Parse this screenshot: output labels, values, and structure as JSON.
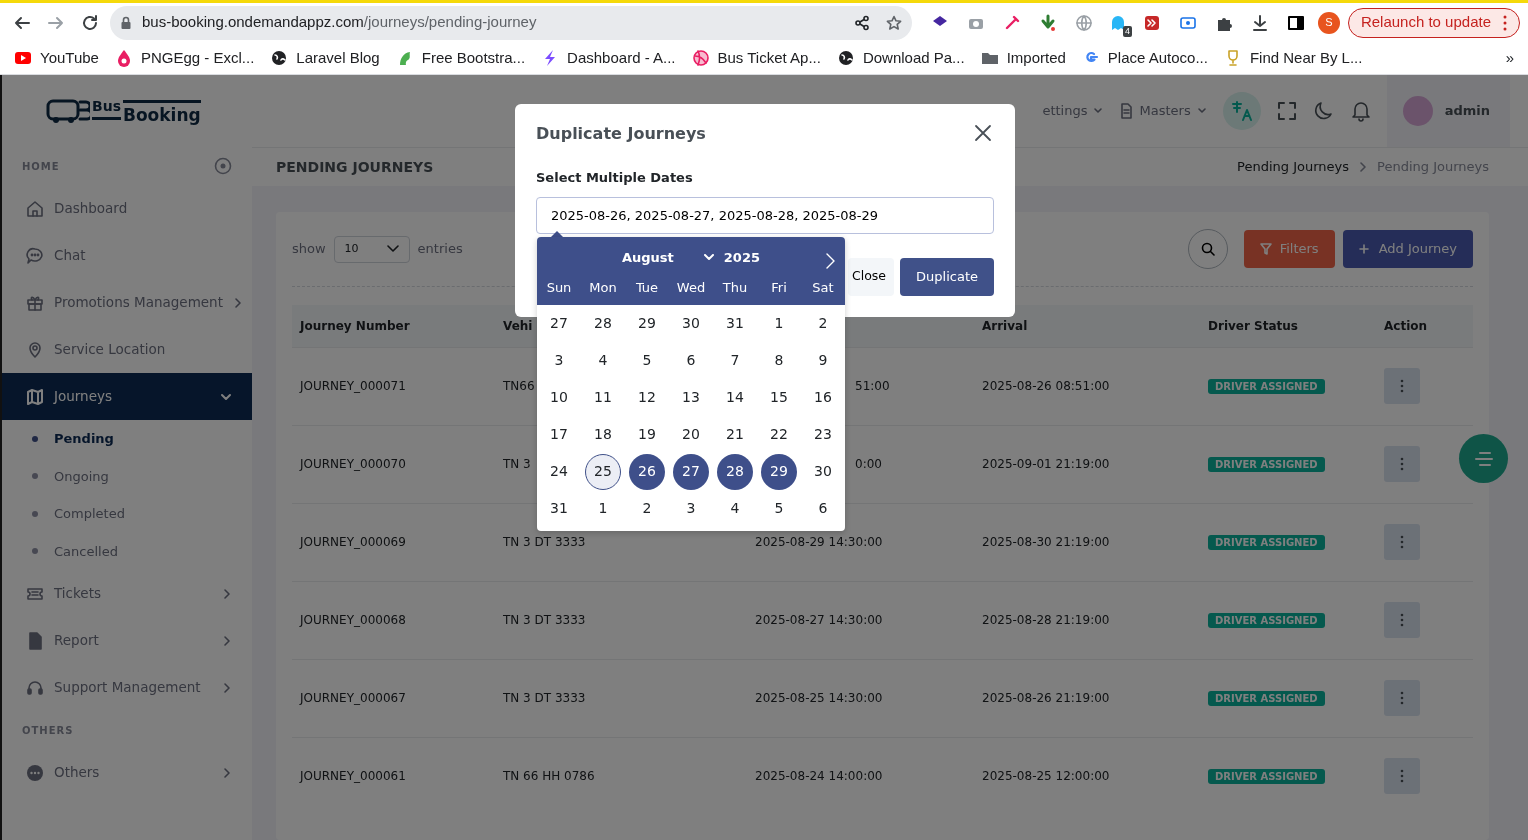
{
  "browser": {
    "url_host": "bus-booking.ondemandappz.com",
    "url_path": "/journeys/pending-journey",
    "extension_badge": "4",
    "profile_initial": "S",
    "relaunch_label": "Relaunch to update",
    "bookmarks": [
      {
        "label": "YouTube"
      },
      {
        "label": "PNGEgg - Excl..."
      },
      {
        "label": "Laravel Blog"
      },
      {
        "label": "Free Bootstra..."
      },
      {
        "label": "Dashboard - A..."
      },
      {
        "label": "Bus Ticket Ap..."
      },
      {
        "label": "Download Pa..."
      },
      {
        "label": "Imported"
      },
      {
        "label": "Place Autoco..."
      },
      {
        "label": "Find Near By L..."
      }
    ],
    "more_bookmarks": "»"
  },
  "logo": {
    "word1": "Bus",
    "word2": "Booking"
  },
  "sidebar": {
    "sections": [
      {
        "heading": "HOME",
        "items": [
          {
            "label": "Dashboard",
            "selected": false
          },
          {
            "label": "Chat",
            "selected": false
          },
          {
            "label": "Promotions Management",
            "selected": false,
            "expanded": false
          },
          {
            "label": "Service Location",
            "selected": false
          },
          {
            "label": "Journeys",
            "selected": true,
            "expanded": true,
            "children": [
              {
                "label": "Pending",
                "selected": true
              },
              {
                "label": "Ongoing",
                "selected": false
              },
              {
                "label": "Completed",
                "selected": false
              },
              {
                "label": "Cancelled",
                "selected": false
              }
            ]
          },
          {
            "label": "Tickets",
            "selected": false,
            "expanded": false
          },
          {
            "label": "Report",
            "selected": false,
            "expanded": false
          },
          {
            "label": "Support Management",
            "selected": false,
            "expanded": false
          }
        ]
      },
      {
        "heading": "OTHERS",
        "items": [
          {
            "label": "Others",
            "selected": false,
            "expanded": false
          }
        ]
      }
    ]
  },
  "topbar": {
    "menus": [
      {
        "label": "ettings"
      },
      {
        "label": "Masters"
      }
    ],
    "user": "admin"
  },
  "page": {
    "title": "PENDING JOURNEYS",
    "breadcrumb": [
      "Pending Journeys",
      "Pending Journeys"
    ]
  },
  "toolbar": {
    "show_label": "show",
    "page_size": "10",
    "entries_label": "entries",
    "filters": "Filters",
    "add": "Add Journey"
  },
  "table": {
    "columns": [
      "Journey Number",
      "Vehi",
      "Arrival",
      "Driver Status",
      "Action"
    ],
    "rows": [
      {
        "journey": "JOURNEY_000071",
        "vehicle": "TN66",
        "departure": "51:00",
        "arrival": "2025-08-26 08:51:00",
        "driver_status": "DRIVER ASSIGNED"
      },
      {
        "journey": "JOURNEY_000070",
        "vehicle": "TN 3",
        "departure": "0:00",
        "arrival": "2025-09-01 21:19:00",
        "driver_status": "DRIVER ASSIGNED"
      },
      {
        "journey": "JOURNEY_000069",
        "vehicle": "TN 3 DT 3333",
        "departure": "2025-08-29 14:30:00",
        "arrival": "2025-08-30 21:19:00",
        "driver_status": "DRIVER ASSIGNED"
      },
      {
        "journey": "JOURNEY_000068",
        "vehicle": "TN 3 DT 3333",
        "departure": "2025-08-27 14:30:00",
        "arrival": "2025-08-28 21:19:00",
        "driver_status": "DRIVER ASSIGNED"
      },
      {
        "journey": "JOURNEY_000067",
        "vehicle": "TN 3 DT 3333",
        "departure": "2025-08-25 14:30:00",
        "arrival": "2025-08-26 21:19:00",
        "driver_status": "DRIVER ASSIGNED"
      },
      {
        "journey": "JOURNEY_000061",
        "vehicle": "TN 66 HH 0786",
        "departure": "2025-08-24 14:00:00",
        "arrival": "2025-08-25 12:00:00",
        "driver_status": "DRIVER ASSIGNED"
      }
    ]
  },
  "modal": {
    "title": "Duplicate Journeys",
    "label": "Select Multiple Dates",
    "value": "2025-08-26, 2025-08-27, 2025-08-28, 2025-08-29",
    "buttons": [
      "Close",
      "Duplicate"
    ],
    "datepicker": {
      "month": "August",
      "year": "2025",
      "weekdays": [
        "Sun",
        "Mon",
        "Tue",
        "Wed",
        "Thu",
        "Fri",
        "Sat"
      ],
      "days": [
        {
          "label": "27",
          "selected": false,
          "today": false
        },
        {
          "label": "28",
          "selected": false,
          "today": false
        },
        {
          "label": "29",
          "selected": false,
          "today": false
        },
        {
          "label": "30",
          "selected": false,
          "today": false
        },
        {
          "label": "31",
          "selected": false,
          "today": false
        },
        {
          "label": "1",
          "selected": false,
          "today": false
        },
        {
          "label": "2",
          "selected": false,
          "today": false
        },
        {
          "label": "3",
          "selected": false,
          "today": false
        },
        {
          "label": "4",
          "selected": false,
          "today": false
        },
        {
          "label": "5",
          "selected": false,
          "today": false
        },
        {
          "label": "6",
          "selected": false,
          "today": false
        },
        {
          "label": "7",
          "selected": false,
          "today": false
        },
        {
          "label": "8",
          "selected": false,
          "today": false
        },
        {
          "label": "9",
          "selected": false,
          "today": false
        },
        {
          "label": "10",
          "selected": false,
          "today": false
        },
        {
          "label": "11",
          "selected": false,
          "today": false
        },
        {
          "label": "12",
          "selected": false,
          "today": false
        },
        {
          "label": "13",
          "selected": false,
          "today": false
        },
        {
          "label": "14",
          "selected": false,
          "today": false
        },
        {
          "label": "15",
          "selected": false,
          "today": false
        },
        {
          "label": "16",
          "selected": false,
          "today": false
        },
        {
          "label": "17",
          "selected": false,
          "today": false
        },
        {
          "label": "18",
          "selected": false,
          "today": false
        },
        {
          "label": "19",
          "selected": false,
          "today": false
        },
        {
          "label": "20",
          "selected": false,
          "today": false
        },
        {
          "label": "21",
          "selected": false,
          "today": false
        },
        {
          "label": "22",
          "selected": false,
          "today": false
        },
        {
          "label": "23",
          "selected": false,
          "today": false
        },
        {
          "label": "24",
          "selected": false,
          "today": false
        },
        {
          "label": "25",
          "selected": false,
          "today": true
        },
        {
          "label": "26",
          "selected": true,
          "today": false
        },
        {
          "label": "27",
          "selected": true,
          "today": false
        },
        {
          "label": "28",
          "selected": true,
          "today": false
        },
        {
          "label": "29",
          "selected": true,
          "today": false
        },
        {
          "label": "30",
          "selected": false,
          "today": false
        },
        {
          "label": "31",
          "selected": false,
          "today": false
        },
        {
          "label": "1",
          "selected": false,
          "today": false
        },
        {
          "label": "2",
          "selected": false,
          "today": false
        },
        {
          "label": "3",
          "selected": false,
          "today": false
        },
        {
          "label": "4",
          "selected": false,
          "today": false
        },
        {
          "label": "5",
          "selected": false,
          "today": false
        },
        {
          "label": "6",
          "selected": false,
          "today": false
        }
      ]
    }
  }
}
